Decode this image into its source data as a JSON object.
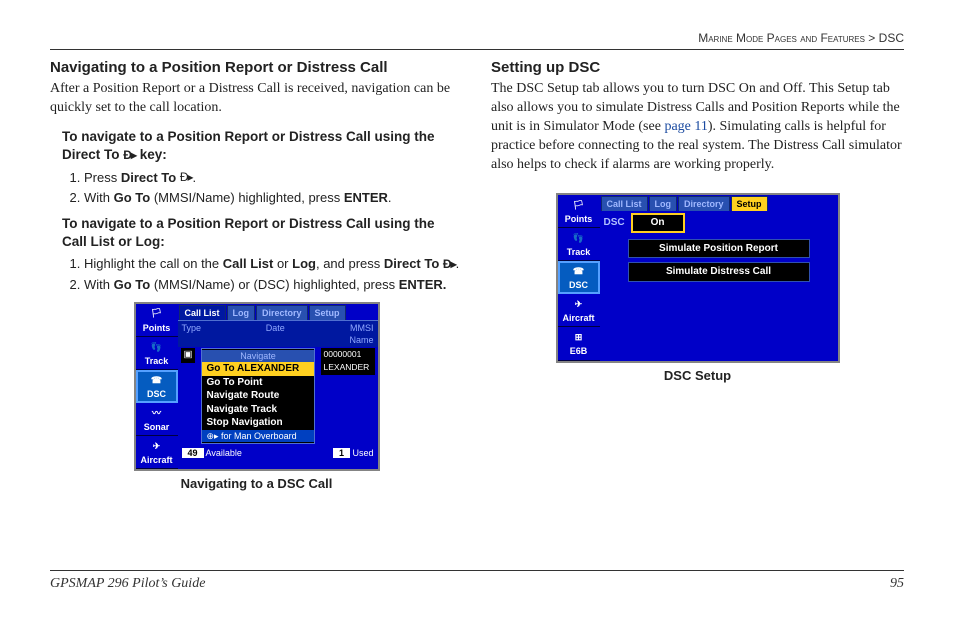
{
  "breadcrumb": {
    "section": "Marine Mode Pages and Features",
    "sep": " > ",
    "page": "DSC"
  },
  "left": {
    "heading": "Navigating to a Position Report or Distress Call",
    "intro": "After a Position Report or a Distress Call is received, navigation can be quickly set to the call location.",
    "block1_head_a": "To navigate to a Position Report or Distress Call using the Direct To ",
    "block1_head_b": " key:",
    "block1_step1_a": "Press ",
    "block1_step1_b": "Direct To ",
    "block1_step1_c": ".",
    "block1_step2_a": "With ",
    "block1_step2_b": "Go To",
    "block1_step2_c": " (MMSI/Name) highlighted, press ",
    "block1_step2_d": "ENTER",
    "block1_step2_e": ".",
    "block2_head": "To navigate to a Position Report or Distress Call using the Call List or Log:",
    "block2_step1_a": "Highlight the call on the ",
    "block2_step1_b": "Call List",
    "block2_step1_c": " or ",
    "block2_step1_d": "Log",
    "block2_step1_e": ", and press ",
    "block2_step1_f": "Direct To ",
    "block2_step1_g": ".",
    "block2_step2_a": "With ",
    "block2_step2_b": "Go To",
    "block2_step2_c": " (MMSI/Name) or (DSC) highlighted, press ",
    "block2_step2_d": "ENTER.",
    "gps": {
      "sidebar": [
        "Points",
        "Track",
        "DSC",
        "Sonar",
        "Aircraft"
      ],
      "tabs": [
        "Call List",
        "Log",
        "Directory",
        "Setup"
      ],
      "hdr_left": "Type",
      "hdr_mid": "Date",
      "hdr_right_l1": "MMSI",
      "hdr_right_l2": "Name",
      "menu_title": "Navigate",
      "menu_items": [
        "Go To ALEXANDER",
        "Go To Point",
        "Navigate Route",
        "Navigate Track",
        "Stop Navigation"
      ],
      "menu_foot": "⊕▸ for Man Overboard",
      "id_num": "00000001",
      "id_name": "LEXANDER",
      "foot_avail_n": "49",
      "foot_avail": "Available",
      "foot_used_n": "1",
      "foot_used": "Used"
    },
    "fig_caption": "Navigating to a DSC Call"
  },
  "right": {
    "heading": "Setting up DSC",
    "p1a": "The DSC Setup tab allows you to turn DSC On and Off. This Setup tab also allows you to simulate Distress Calls and Position Reports while the unit is in Simulator Mode (see ",
    "p1_link": "page 11",
    "p1b": "). Simulating calls is helpful for practice before connecting to the real system. The Distress Call simulator also helps to check if alarms are working properly.",
    "gps": {
      "sidebar": [
        "Points",
        "Track",
        "DSC",
        "Aircraft",
        "E6B"
      ],
      "tabs": [
        "Call List",
        "Log",
        "Directory",
        "Setup"
      ],
      "dsc_label": "DSC",
      "dsc_value": "On",
      "row1": "Simulate Position Report",
      "row2": "Simulate Distress Call"
    },
    "fig_caption": "DSC Setup"
  },
  "footer": {
    "guide": "GPSMAP 296 Pilot’s Guide",
    "page": "95"
  },
  "icons": {
    "direct_to": "Đ▸"
  }
}
